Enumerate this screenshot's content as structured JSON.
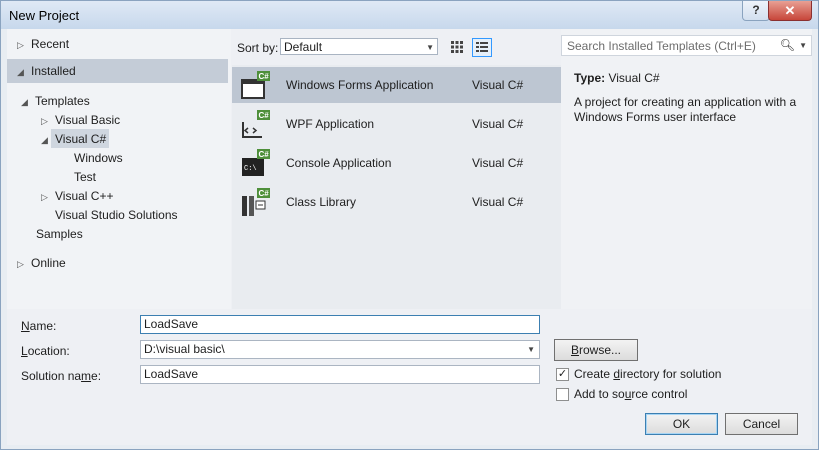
{
  "window": {
    "title": "New Project",
    "help_label": "?",
    "close_label": "✕"
  },
  "tree": {
    "recent": "Recent",
    "installed": "Installed",
    "templates": "Templates",
    "visual_basic": "Visual Basic",
    "visual_csharp": "Visual C#",
    "windows": "Windows",
    "test": "Test",
    "visual_cpp": "Visual C++",
    "vs_solutions": "Visual Studio Solutions",
    "samples": "Samples",
    "online": "Online"
  },
  "sort": {
    "label": "Sort by:",
    "value": "Default"
  },
  "templates": [
    {
      "name": "Windows Forms Application",
      "language": "Visual C#",
      "icon": "winforms-icon",
      "selected": true
    },
    {
      "name": "WPF Application",
      "language": "Visual C#",
      "icon": "wpf-icon",
      "selected": false
    },
    {
      "name": "Console Application",
      "language": "Visual C#",
      "icon": "console-icon",
      "selected": false
    },
    {
      "name": "Class Library",
      "language": "Visual C#",
      "icon": "class-library-icon",
      "selected": false
    }
  ],
  "search": {
    "placeholder": "Search Installed Templates (Ctrl+E)"
  },
  "description": {
    "type_label": "Type:",
    "type_value": "Visual C#",
    "text": "A project for creating an application with a Windows Forms user interface"
  },
  "form": {
    "name_label_pre": "",
    "name_label_u": "N",
    "name_label_post": "ame:",
    "name_value": "LoadSave",
    "location_label_pre": "",
    "location_label_u": "L",
    "location_label_post": "ocation:",
    "location_value": "D:\\visual basic\\",
    "solution_label_pre": "Solution na",
    "solution_label_u": "m",
    "solution_label_post": "e:",
    "solution_value": "LoadSave",
    "browse_pre": "",
    "browse_u": "B",
    "browse_post": "rowse...",
    "create_dir_pre": "Create ",
    "create_dir_u": "d",
    "create_dir_post": "irectory for solution",
    "create_dir_checked": true,
    "source_control_pre": "Add to so",
    "source_control_u": "u",
    "source_control_post": "rce control",
    "source_control_checked": false,
    "ok_label": "OK",
    "cancel_label": "Cancel"
  },
  "colors": {
    "accent": "#3399ff",
    "csharp_green": "#4e8f3a"
  }
}
